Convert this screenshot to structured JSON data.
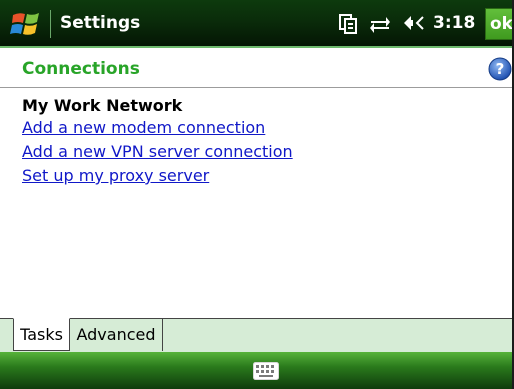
{
  "titlebar": {
    "app_title": "Settings",
    "clock": "3:18",
    "ok_label": "ok",
    "icons": [
      "start-windows-icon",
      "clipboard-sync-icon",
      "data-connectivity-icon",
      "volume-icon"
    ]
  },
  "page": {
    "title": "Connections",
    "help_icon": "help-icon"
  },
  "content": {
    "heading": "My Work Network",
    "links": [
      "Add a new modem connection",
      "Add a new VPN server connection",
      "Set up my proxy server"
    ]
  },
  "tabs": [
    {
      "label": "Tasks",
      "active": true
    },
    {
      "label": "Advanced",
      "active": false
    }
  ],
  "softbar": {
    "center_icon": "keyboard-icon"
  },
  "colors": {
    "title_bar": "#0a2c0a",
    "page_title": "#28a428",
    "link": "#1018c8",
    "tab_bar": "#d6ecd6",
    "soft_bar": "#2a7a1c",
    "ok_button": "#4fae2b"
  }
}
